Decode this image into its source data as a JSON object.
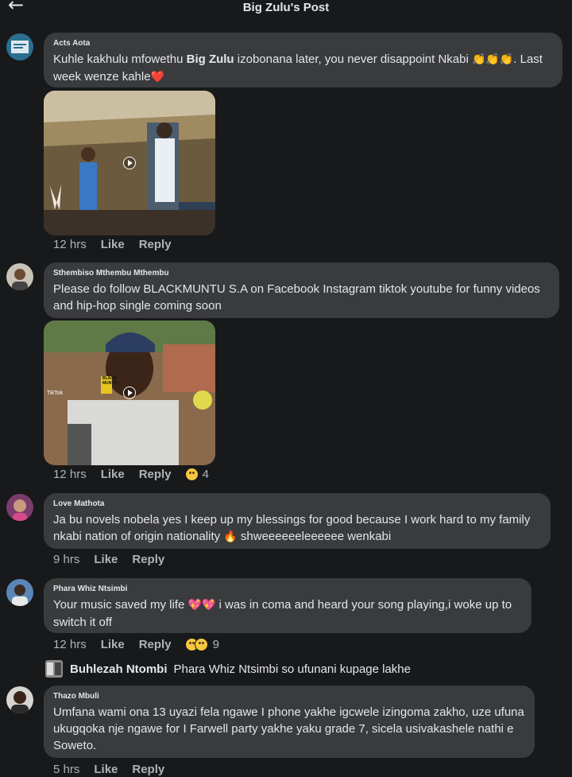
{
  "header": {
    "title": "Big Zulu's Post",
    "back_icon": "arrow-left-icon"
  },
  "comments": [
    {
      "author": "Acts Aota",
      "text_parts": [
        "Kuhle kakhulu mfowethu ",
        "Big Zulu",
        " izobonana later, you never disappoint Nkabi ",
        "👏👏👏",
        ". Last week wenze kahle",
        "❤️"
      ],
      "time": "12 hrs",
      "like": "Like",
      "reply": "Reply"
    },
    {
      "author": "Sthembiso Mthembu Mthembu",
      "text": "Please do follow BLACKMUNTU S.A on Facebook Instagram tiktok youtube for funny videos and hip-hop single coming soon",
      "time": "12 hrs",
      "like": "Like",
      "reply": "Reply",
      "reactions": "4",
      "video_overlay": {
        "tiktok": "TikTok",
        "shirt": "BLACK MUNTU"
      }
    },
    {
      "author": "Love Mathota",
      "text_parts": [
        "Ja bu novels nobela yes I keep up my blessings for good because I work hard to my family nkabi nation of origin nationality ",
        "🔥",
        " shweeeeeeleeeeee wenkabi"
      ],
      "time": "9 hrs",
      "like": "Like",
      "reply": "Reply"
    },
    {
      "author": "Phara Whiz Ntsimbi",
      "text_parts": [
        "Your music saved my life ",
        "💖💖",
        " i was in coma and heard your song playing,i woke up to switch it off"
      ],
      "time": "12 hrs",
      "like": "Like",
      "reply": "Reply",
      "reactions": "9"
    },
    {
      "author": "Thazo Mbuli",
      "text": "Umfana wami ona 13 uyazi fela ngawe I phone yakhe igcwele izingoma zakho, uze ufuna ukugqoka nje ngawe for I Farwell party yakhe yaku grade 7, sicela usivakashele nathi e Soweto.",
      "time": "5 hrs",
      "like": "Like",
      "reply": "Reply"
    }
  ],
  "reply_preview": {
    "author": "Buhlezah Ntombi",
    "text": "Phara Whiz Ntsimbi so ufunani kupage lakhe"
  },
  "colors": {
    "background": "#18191a",
    "bubble": "#3a3b3c",
    "muted": "#b0b3b8"
  }
}
